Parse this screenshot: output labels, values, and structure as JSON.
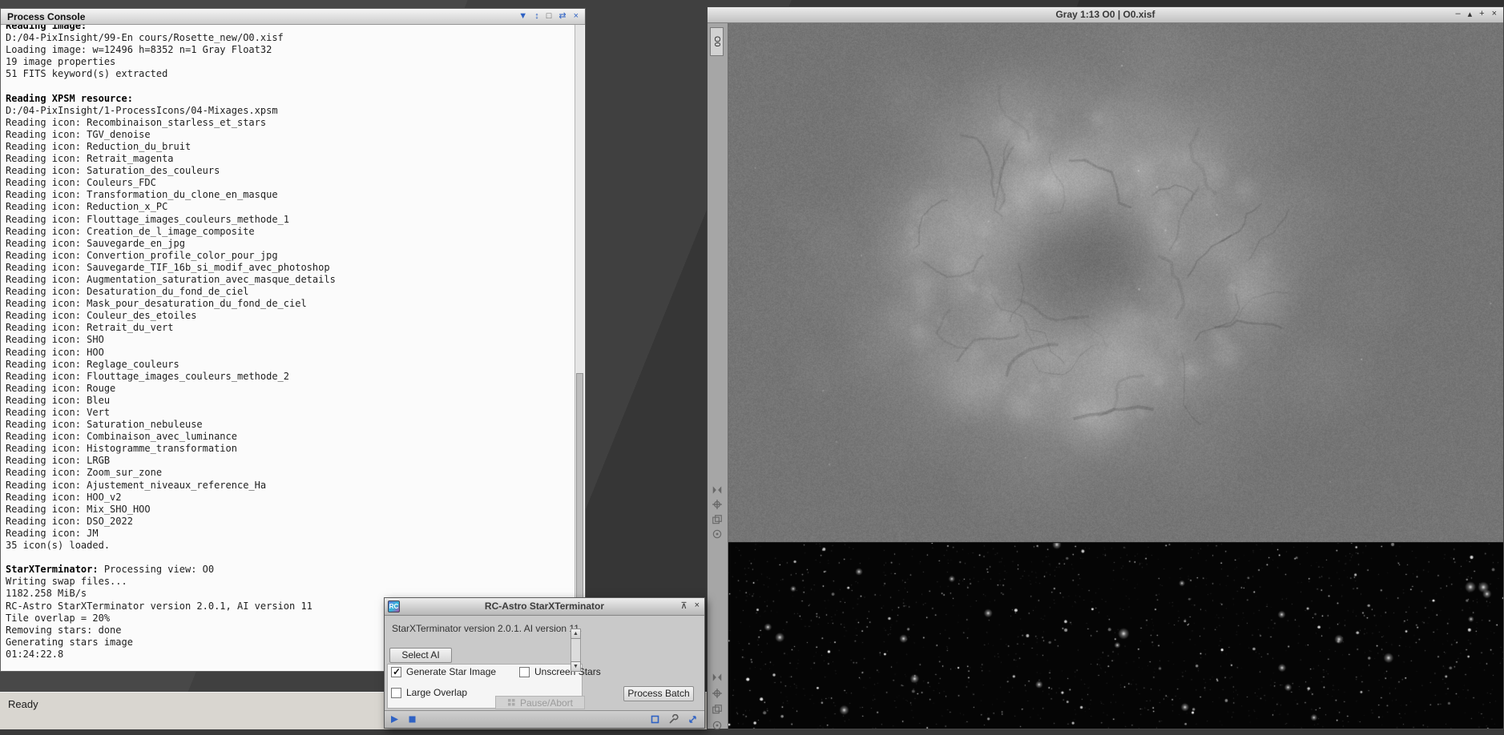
{
  "colors": {
    "accent_blue": "#2f62c4",
    "desktop": "#3a3a3a",
    "console_bg": "#fbfbfb",
    "dialog_bg": "#c9c9c9"
  },
  "console": {
    "title": "Process Console",
    "icons": {
      "menu": "▼",
      "expand": "↕",
      "float": "□",
      "dock": "⇄",
      "close": "×"
    },
    "lines": [
      {
        "b": "Reading image:"
      },
      {
        "t": "D:/04-PixInsight/99-En cours/Rosette_new/O0.xisf"
      },
      {
        "t": "Loading image: w=12496 h=8352 n=1 Gray Float32"
      },
      {
        "t": "19 image properties"
      },
      {
        "t": "51 FITS keyword(s) extracted"
      },
      {},
      {
        "b": "Reading XPSM resource:"
      },
      {
        "t": "D:/04-PixInsight/1-ProcessIcons/04-Mixages.xpsm"
      },
      {
        "t": "Reading icon: Recombinaison_starless_et_stars"
      },
      {
        "t": "Reading icon: TGV_denoise"
      },
      {
        "t": "Reading icon: Reduction_du_bruit"
      },
      {
        "t": "Reading icon: Retrait_magenta"
      },
      {
        "t": "Reading icon: Saturation_des_couleurs"
      },
      {
        "t": "Reading icon: Couleurs_FDC"
      },
      {
        "t": "Reading icon: Transformation_du_clone_en_masque"
      },
      {
        "t": "Reading icon: Reduction_x_PC"
      },
      {
        "t": "Reading icon: Flouttage_images_couleurs_methode_1"
      },
      {
        "t": "Reading icon: Creation_de_l_image_composite"
      },
      {
        "t": "Reading icon: Sauvegarde_en_jpg"
      },
      {
        "t": "Reading icon: Convertion_profile_color_pour_jpg"
      },
      {
        "t": "Reading icon: Sauvegarde_TIF_16b_si_modif_avec_photoshop"
      },
      {
        "t": "Reading icon: Augmentation_saturation_avec_masque_details"
      },
      {
        "t": "Reading icon: Desaturation_du_fond_de_ciel"
      },
      {
        "t": "Reading icon: Mask_pour_desaturation_du_fond_de_ciel"
      },
      {
        "t": "Reading icon: Couleur_des_etoiles"
      },
      {
        "t": "Reading icon: Retrait_du_vert"
      },
      {
        "t": "Reading icon: SHO"
      },
      {
        "t": "Reading icon: HOO"
      },
      {
        "t": "Reading icon: Reglage_couleurs"
      },
      {
        "t": "Reading icon: Flouttage_images_couleurs_methode_2"
      },
      {
        "t": "Reading icon: Rouge"
      },
      {
        "t": "Reading icon: Bleu"
      },
      {
        "t": "Reading icon: Vert"
      },
      {
        "t": "Reading icon: Saturation_nebuleuse"
      },
      {
        "t": "Reading icon: Combinaison_avec_luminance"
      },
      {
        "t": "Reading icon: Histogramme_transformation"
      },
      {
        "t": "Reading icon: LRGB"
      },
      {
        "t": "Reading icon: Zoom_sur_zone"
      },
      {
        "t": "Reading icon: Ajustement_niveaux_reference_Ha"
      },
      {
        "t": "Reading icon: HOO_v2"
      },
      {
        "t": "Reading icon: Mix_SHO_HOO"
      },
      {
        "t": "Reading icon: DSO_2022"
      },
      {
        "t": "Reading icon: JM"
      },
      {
        "t": "35 icon(s) loaded."
      },
      {},
      {
        "b": "StarXTerminator: ",
        "t": "Processing view: O0"
      },
      {
        "t": "Writing swap files..."
      },
      {
        "t": "1182.258 MiB/s"
      },
      {
        "t": "RC-Astro StarXTerminator version 2.0.1, AI version 11"
      },
      {
        "t": "Tile overlap = 20%"
      },
      {
        "t": "Removing stars: done"
      },
      {
        "t": "Generating stars image"
      },
      {
        "t": "01:24:22.8"
      }
    ]
  },
  "statusbar": {
    "text": "Ready"
  },
  "image_window": {
    "title": "Gray 1:13 O0 | O0.xisf",
    "view_tab": "O0",
    "icons": {
      "minimize": "–",
      "shade": "▴",
      "maximize": "+",
      "close": "×"
    }
  },
  "dialog": {
    "title": "RC-Astro StarXTerminator",
    "logo_text": "RC",
    "version_text": "StarXTerminator version 2.0.1. AI version 11.",
    "select_ai": "Select AI",
    "generate_star_image": {
      "label": "Generate Star Image",
      "checked": true
    },
    "unscreen_stars": {
      "label": "Unscreen Stars",
      "checked": false
    },
    "large_overlap": {
      "label": "Large Overlap",
      "checked": false
    },
    "process_batch": "Process Batch",
    "pause_abort": "Pause/Abort",
    "titlebar_icons": {
      "pin": "⊼",
      "close": "×"
    },
    "scroll_icons": {
      "up": "▲",
      "down": "▼"
    }
  }
}
